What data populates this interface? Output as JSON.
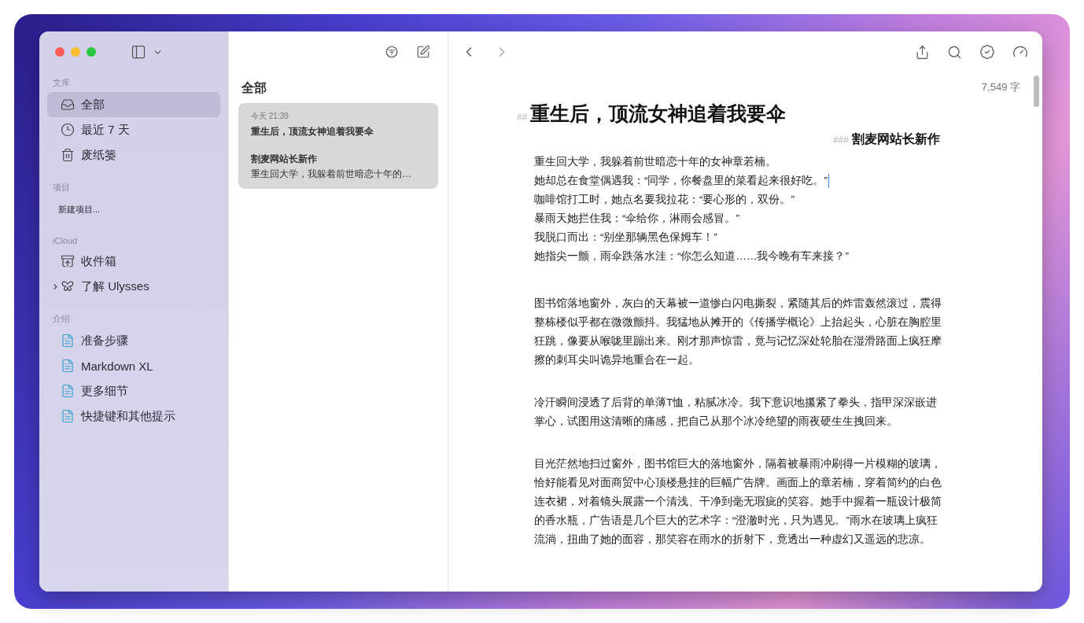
{
  "sidebar": {
    "sections": [
      {
        "label": "文库",
        "items": [
          {
            "kind": "all",
            "label": "全部",
            "selected": true
          },
          {
            "kind": "recent",
            "label": "最近 7 天",
            "selected": false
          },
          {
            "kind": "trash",
            "label": "废纸篓",
            "selected": false
          }
        ]
      },
      {
        "label": "项目",
        "items": [
          {
            "kind": "new",
            "label": "新建项目...",
            "selected": false
          }
        ]
      },
      {
        "label": "iCloud",
        "items": [
          {
            "kind": "inbox",
            "label": "收件箱",
            "selected": false
          },
          {
            "kind": "group",
            "label": "了解 Ulysses",
            "selected": false,
            "expanded": false
          }
        ]
      },
      {
        "label": "介绍",
        "items": [
          {
            "kind": "doc",
            "label": "准备步骤",
            "selected": false
          },
          {
            "kind": "doc",
            "label": "Markdown XL",
            "selected": false
          },
          {
            "kind": "doc",
            "label": "更多细节",
            "selected": false
          },
          {
            "kind": "doc",
            "label": "快捷键和其他提示",
            "selected": false
          }
        ]
      }
    ]
  },
  "sheet_list": {
    "title": "全部",
    "sheets": [
      {
        "date": "今天 21:39",
        "title": "重生后，顶流女神追着我要伞",
        "subtitle": "割麦网站长新作",
        "excerpt": "重生回大学，我躲着前世暗恋十年的…",
        "selected": true
      }
    ]
  },
  "editor": {
    "word_count": "7,549 字",
    "heading": {
      "marker": "##",
      "text": "重生后，顶流女神追着我要伞"
    },
    "subheading": {
      "marker": "###",
      "text": "割麦网站长新作"
    },
    "lines": [
      {
        "text": "重生回大学，我躲着前世暗恋十年的女神章若楠。",
        "cursor": false
      },
      {
        "text": "她却总在食堂偶遇我：“同学，你餐盘里的菜看起来很好吃。”",
        "cursor": true
      },
      {
        "text": "咖啡馆打工时，她点名要我拉花：“要心形的，双份。”",
        "cursor": false
      },
      {
        "text": "暴雨天她拦住我：“伞给你，淋雨会感冒。”",
        "cursor": false
      },
      {
        "text": "我脱口而出：“别坐那辆黑色保姆车！”",
        "cursor": false
      },
      {
        "text": "她指尖一颤，雨伞跌落水洼：“你怎么知道……我今晚有车来接？”",
        "cursor": false
      }
    ],
    "paragraphs": [
      "图书馆落地窗外，灰白的天幕被一道惨白闪电撕裂，紧随其后的炸雷轰然滚过，震得整栋楼似乎都在微微颤抖。我猛地从摊开的《传播学概论》上抬起头，心脏在胸腔里狂跳，像要从喉咙里蹦出来。刚才那声惊雷，竟与记忆深处轮胎在湿滑路面上疯狂摩擦的刺耳尖叫诡异地重合在一起。",
      "冷汗瞬间浸透了后背的单薄T恤，粘腻冰冷。我下意识地攥紧了拳头，指甲深深嵌进掌心，试图用这清晰的痛感，把自己从那个冰冷绝望的雨夜硬生生拽回来。",
      "目光茫然地扫过窗外，图书馆巨大的落地窗外，隔着被暴雨冲刷得一片模糊的玻璃，恰好能看见对面商贸中心顶楼悬挂的巨幅广告牌。画面上的章若楠，穿着简约的白色连衣裙，对着镜头展露一个清浅、干净到毫无瑕疵的笑容。她手中握着一瓶设计极简的香水瓶，广告语是几个巨大的艺术字：“澄澈时光，只为遇见。”雨水在玻璃上疯狂流淌，扭曲了她的面容，那笑容在雨水的折射下，竟透出一种虚幻又遥远的悲凉。"
    ]
  }
}
